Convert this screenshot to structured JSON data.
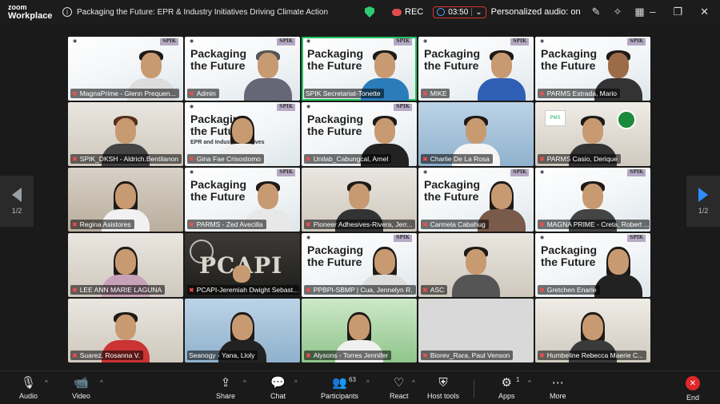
{
  "app": {
    "logo_line1": "zoom",
    "logo_line2": "Workplace"
  },
  "meeting": {
    "title": "Packaging the Future: EPR & Industry Initiatives Driving Climate Action",
    "rec_label": "REC",
    "timer": "03:50",
    "personalized_audio": "Personalized audio: on"
  },
  "paging": {
    "left_label": "1/2",
    "right_label": "1/2"
  },
  "slide": {
    "line1": "Packaging",
    "line2": "the Future",
    "sub": "EPR and Industry Initiatives",
    "logo": "SPIK"
  },
  "participants": [
    {
      "name": "MagnaPrime - Glenn Prequen..."
    },
    {
      "name": "Admin"
    },
    {
      "name": "SPIK Secretariat-Tonette"
    },
    {
      "name": "MIKE"
    },
    {
      "name": "PARMS Estrada, Mario"
    },
    {
      "name": "SPIK_DKSH - Aldrich.Bentilanon"
    },
    {
      "name": "Gina Fae Crisostomo"
    },
    {
      "name": "Unilab_Cabungcal, Arnel"
    },
    {
      "name": "Charlie De La Rosa"
    },
    {
      "name": "PARMS Casio, Derique"
    },
    {
      "name": "Regina Asistores"
    },
    {
      "name": "PARMS - Zed Avecilla"
    },
    {
      "name": "Pioneer Adhesives-Rivera, Jerr..."
    },
    {
      "name": "Carmela Cabahug"
    },
    {
      "name": "MAGNA PRIME - Creta, Robert ..."
    },
    {
      "name": "LEE ANN MARIE LAGUNA"
    },
    {
      "name": "PCAPI-Jeremiah Dwight Sebast..."
    },
    {
      "name": "PPBPI-SBMP | Cua, Jennelyn R."
    },
    {
      "name": "ASC"
    },
    {
      "name": "Gretchen Enarle"
    },
    {
      "name": "Suarez, Rosanna V."
    },
    {
      "name": "Seanogy - Yana, Lloly"
    },
    {
      "name": "Alysons - Torres Jennifer"
    },
    {
      "name": "Biorev_Rara, Paul Venson"
    },
    {
      "name": "Humbeline Rebecca Maerie C..."
    }
  ],
  "backgrounds": {
    "pcapi_text": "PCAPI",
    "pms_text": "PMS"
  },
  "toolbar": {
    "audio": "Audio",
    "video": "Video",
    "share": "Share",
    "chat": "Chat",
    "participants": "Participants",
    "participants_count": "63",
    "react": "React",
    "host_tools": "Host tools",
    "apps": "Apps",
    "apps_count": "1",
    "more": "More",
    "end": "End"
  }
}
